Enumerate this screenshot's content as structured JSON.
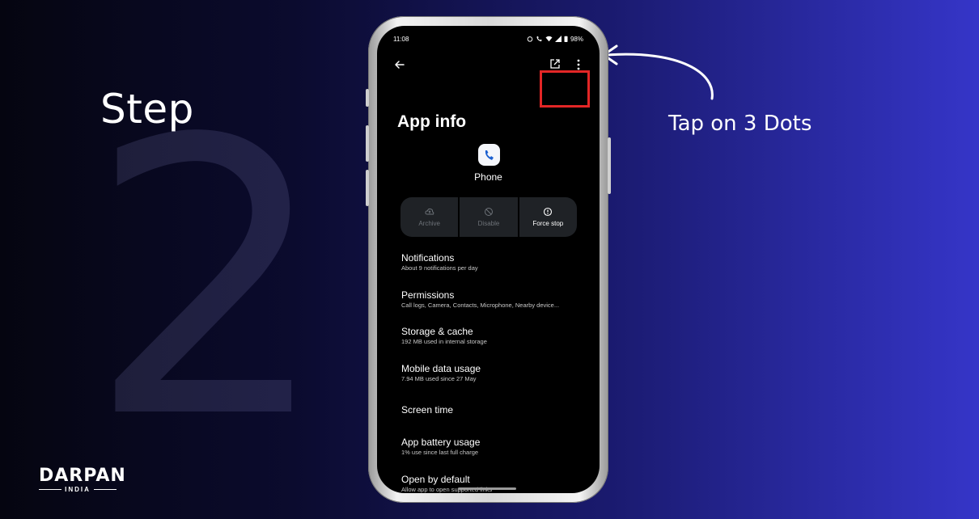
{
  "slide": {
    "step_word": "Step",
    "step_number": "2",
    "annotation": "Tap on 3 Dots",
    "brand_name": "DARPAN",
    "brand_sub": "INDIA",
    "highlight_color": "#e32626"
  },
  "status_bar": {
    "time": "11:08",
    "battery": "98%"
  },
  "app_bar": {
    "back_icon": "arrow-left-icon",
    "open_icon": "open-in-new-icon",
    "more_icon": "more-vertical-icon"
  },
  "app_info": {
    "title": "App info",
    "app_name": "Phone",
    "app_icon": "phone-icon",
    "actions": [
      {
        "label": "Archive",
        "icon": "cloud-upload-icon",
        "enabled": false
      },
      {
        "label": "Disable",
        "icon": "block-icon",
        "enabled": false
      },
      {
        "label": "Force stop",
        "icon": "alert-circle-icon",
        "enabled": true
      }
    ],
    "items": [
      {
        "title": "Notifications",
        "subtitle": "About 9 notifications per day"
      },
      {
        "title": "Permissions",
        "subtitle": "Call logs, Camera, Contacts, Microphone, Nearby device..."
      },
      {
        "title": "Storage & cache",
        "subtitle": "192 MB used in internal storage"
      },
      {
        "title": "Mobile data usage",
        "subtitle": "7.94 MB used since 27 May"
      },
      {
        "title": "Screen time",
        "subtitle": ""
      },
      {
        "title": "App battery usage",
        "subtitle": "1% use since last full charge"
      },
      {
        "title": "Open by default",
        "subtitle": "Allow app to open supported links"
      }
    ]
  }
}
